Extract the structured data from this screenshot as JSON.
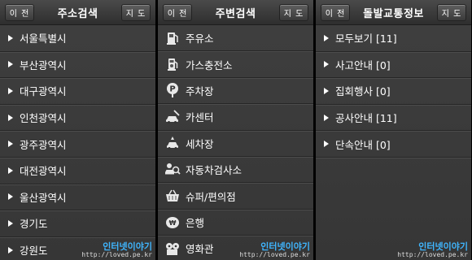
{
  "panels": [
    {
      "left_button": "이 전",
      "title": "주소검색",
      "right_button": "지 도",
      "items": [
        "서울특별시",
        "부산광역시",
        "대구광역시",
        "인천광역시",
        "광주광역시",
        "대전광역시",
        "울산광역시",
        "경기도",
        "강원도"
      ]
    },
    {
      "left_button": "이 전",
      "title": "주변검색",
      "right_button": "지 도",
      "items": [
        {
          "label": "주유소",
          "icon": "gas-pump-icon"
        },
        {
          "label": "가스충전소",
          "icon": "gas-station-icon"
        },
        {
          "label": "주차장",
          "icon": "parking-icon"
        },
        {
          "label": "카센터",
          "icon": "car-repair-icon"
        },
        {
          "label": "세차장",
          "icon": "car-wash-icon"
        },
        {
          "label": "자동차검사소",
          "icon": "car-inspection-icon"
        },
        {
          "label": "슈퍼/편의점",
          "icon": "shopping-basket-icon"
        },
        {
          "label": "은행",
          "icon": "bank-icon"
        },
        {
          "label": "영화관",
          "icon": "film-reel-icon"
        }
      ]
    },
    {
      "left_button": "이 전",
      "title": "돌발교통정보",
      "right_button": "지 도",
      "items": [
        "모두보기 [11]",
        "사고안내 [0]",
        "집회행사 [0]",
        "공사안내 [11]",
        "단속안내 [0]"
      ]
    }
  ],
  "watermark": {
    "brand": "인터넷이야기",
    "url": "http://loved.pe.kr"
  }
}
